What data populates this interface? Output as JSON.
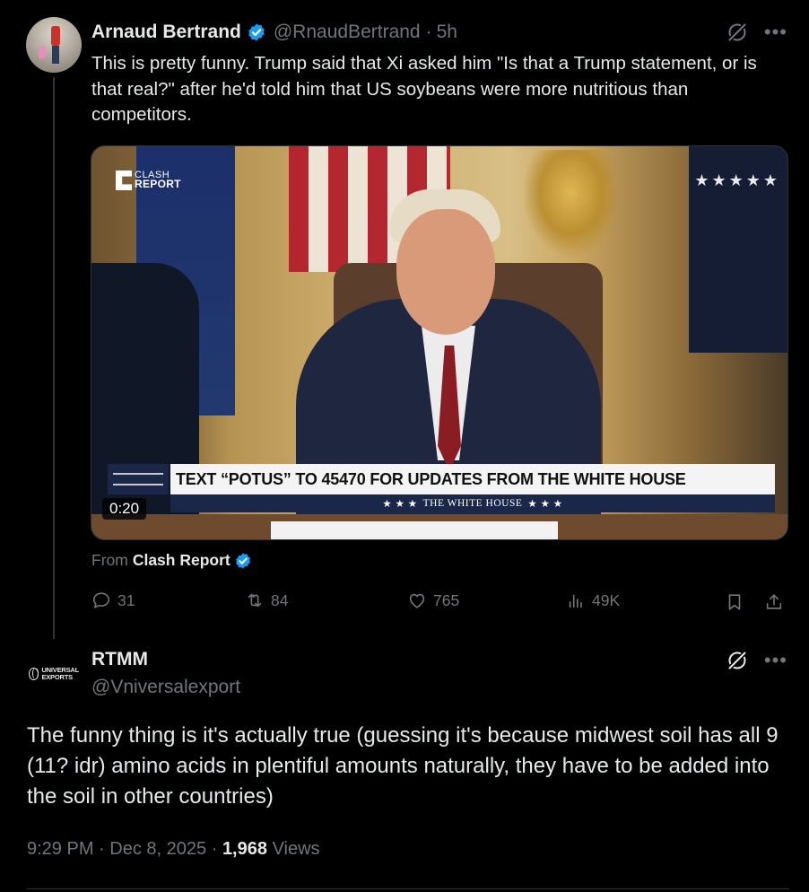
{
  "tweet": {
    "author_name": "Arnaud Bertrand",
    "handle": "@RnaudBertrand",
    "separator": "·",
    "time": "5h",
    "text": "This is pretty funny. Trump said that Xi asked him \"Is that a Trump statement, or is that real?\" after he'd told him that US soybeans were more nutritious than competitors.",
    "media": {
      "logo_line1": "CLASH",
      "logo_line2": "REPORT",
      "banner_text": "TEXT “POTUS” TO 45470 FOR UPDATES FROM THE WHITE HOUSE",
      "banner_sub_left": "★ ★ ★",
      "banner_sub": "THE WHITE HOUSE",
      "banner_sub_right": "★ ★ ★",
      "stars": "★★★★★",
      "duration": "0:20"
    },
    "from_label": "From",
    "from_source": "Clash Report",
    "actions": {
      "replies": "31",
      "reposts": "84",
      "likes": "765",
      "views": "49K"
    }
  },
  "reply": {
    "avatar_line1": "UNIVERSAL",
    "avatar_line2": "EXPORTS",
    "author_name": "RTMM",
    "handle": "@Vniversalexport",
    "text": "The funny thing is it's actually true (guessing it's because midwest soil has all 9 (11? idr) amino acids in plentiful amounts naturally, they have to be added into the soil in other countries)",
    "time": "9:29 PM",
    "sep1": "·",
    "date": "Dec 8, 2025",
    "sep2": "·",
    "views_count": "1,968",
    "views_label": "Views"
  },
  "more_icon": "•••",
  "colors": {
    "background": "#000000",
    "text_primary": "#e7e9ea",
    "text_secondary": "#71767b",
    "verified_blue": "#1d9bf0",
    "divider": "#2f3336"
  }
}
